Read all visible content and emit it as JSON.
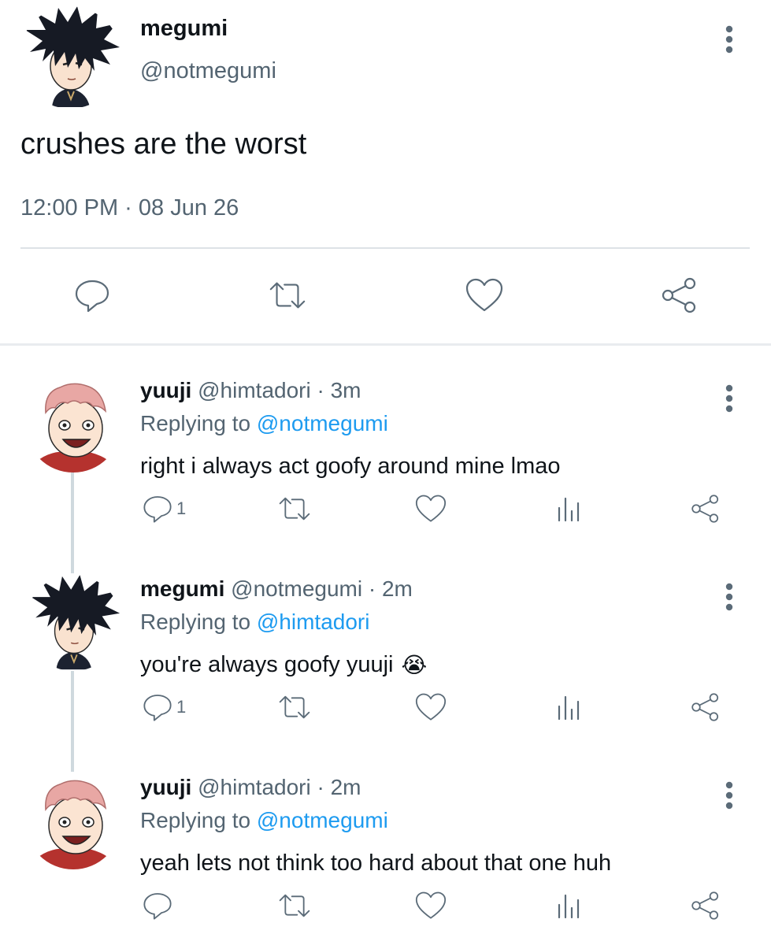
{
  "main_tweet": {
    "name": "megumi",
    "handle": "@notmegumi",
    "text": "crushes are the worst",
    "timestamp": "12:00 PM · 08 Jun 26",
    "actions": [
      "reply-icon",
      "retweet-icon",
      "like-icon",
      "share-icon"
    ]
  },
  "replies": [
    {
      "name": "yuuji",
      "handle": "@himtadori",
      "time": "· 3m",
      "replying_label": "Replying to",
      "replying_to": "@notmegumi",
      "text": "right i always act goofy around mine lmao",
      "reply_count": "1",
      "avatar": "yuuji-avatar"
    },
    {
      "name": "megumi",
      "handle": "@notmegumi",
      "time": "· 2m",
      "replying_label": "Replying to",
      "replying_to": "@himtadori",
      "text": "you're always goofy yuuji",
      "emoji": "😭",
      "reply_count": "1",
      "avatar": "megumi-avatar"
    },
    {
      "name": "yuuji",
      "handle": "@himtadori",
      "time": "· 2m",
      "replying_label": "Replying to",
      "replying_to": "@notmegumi",
      "text": "yeah lets not think too hard about that one huh",
      "reply_count": "",
      "avatar": "yuuji-avatar"
    }
  ],
  "colors": {
    "text": "#0f1419",
    "secondary": "#536471",
    "link": "#1d9bf0",
    "icon": "#5b6b78",
    "thread_line": "#cfd9de"
  }
}
